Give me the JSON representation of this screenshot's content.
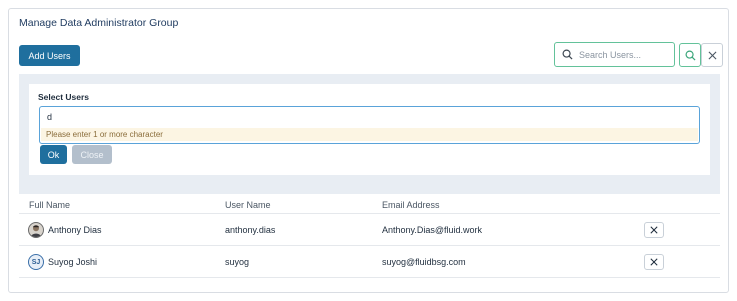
{
  "header": {
    "title": "Manage Data Administrator Group"
  },
  "toolbar": {
    "add_users_label": "Add Users"
  },
  "search": {
    "placeholder": "Search Users...",
    "value": ""
  },
  "select_users": {
    "label": "Select Users",
    "input_value": "d",
    "hint": "Please enter 1 or more character",
    "ok_label": "Ok",
    "close_label": "Close"
  },
  "table": {
    "columns": [
      "Full Name",
      "User Name",
      "Email Address"
    ],
    "rows": [
      {
        "avatar": "photo",
        "full_name": "Anthony Dias",
        "user_name": "anthony.dias",
        "email": "Anthony.Dias@fluid.work"
      },
      {
        "avatar": "SJ",
        "full_name": "Suyog Joshi",
        "user_name": "suyog",
        "email": "suyog@fluidbsg.com"
      }
    ]
  },
  "colors": {
    "primary": "#1f6f9e",
    "search_border": "#63c29a",
    "focus_border": "#5aa3d9",
    "hint_bg": "#fcf5e3"
  },
  "icons": {
    "search": "search-icon",
    "clear": "close-icon",
    "remove": "close-icon"
  }
}
